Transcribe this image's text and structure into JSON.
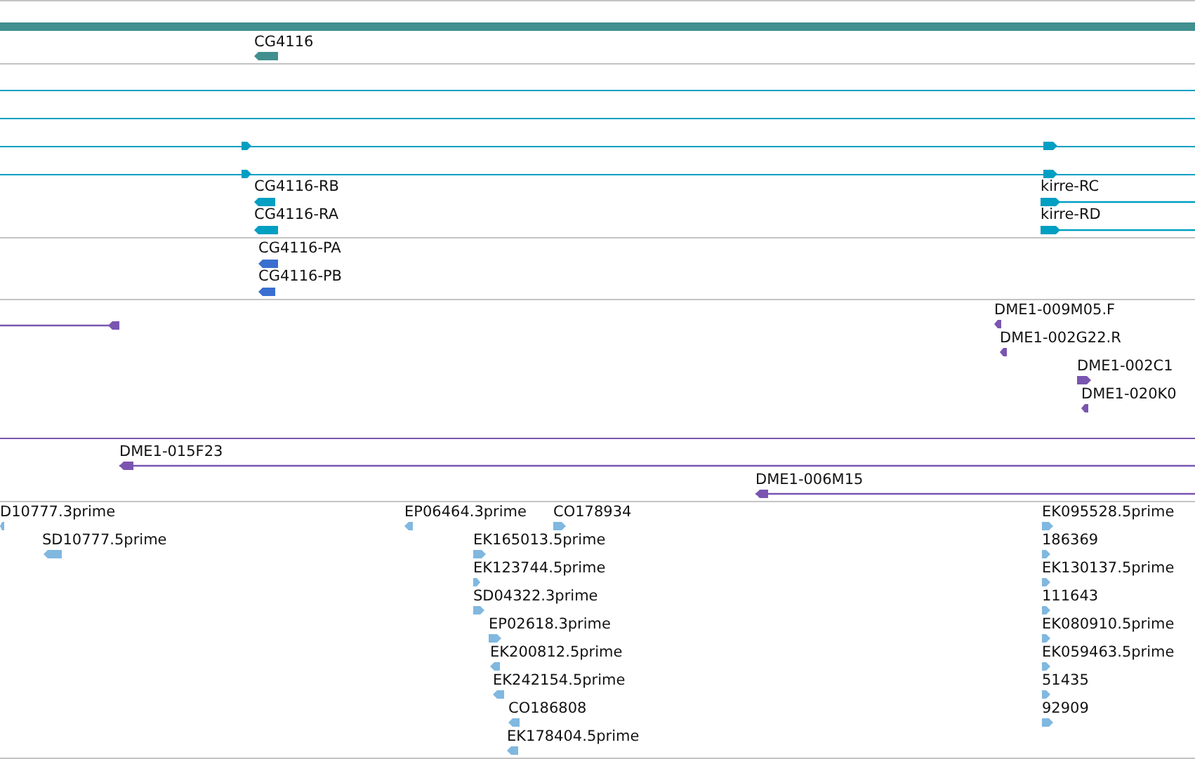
{
  "tracks": [
    {
      "features": [
        {
          "label": "CG4116",
          "reverse": true
        }
      ]
    },
    {
      "features": [
        {
          "reverse": false
        },
        {
          "reverse": false
        },
        {
          "reverse": false
        },
        {
          "reverse": false
        },
        {
          "label": "CG4116-RB",
          "reverse": true
        },
        {
          "label": "CG4116-RA",
          "reverse": true
        },
        {
          "label": "kirre-RC",
          "reverse": false
        },
        {
          "label": "kirre-RD",
          "reverse": false
        }
      ]
    },
    {
      "features": [
        {
          "label": "CG4116-PA",
          "reverse": true
        },
        {
          "label": "CG4116-PB",
          "reverse": true
        }
      ]
    },
    {
      "features": [
        {
          "reverse": true
        },
        {
          "label": "DME1-009M05.F",
          "reverse": true
        },
        {
          "label": "DME1-002G22.R",
          "reverse": true
        },
        {
          "label": "DME1-002C1",
          "reverse": false
        },
        {
          "label": "DME1-020K0",
          "reverse": true
        },
        {
          "label": "DME1-015F23",
          "reverse": true
        },
        {
          "label": "DME1-006M15",
          "reverse": true
        }
      ]
    },
    {
      "features": [
        {
          "label": "D10777.3prime",
          "reverse": true
        },
        {
          "label": "SD10777.5prime",
          "reverse": true
        },
        {
          "label": "EP06464.3prime",
          "reverse": true
        },
        {
          "label": "CO178934",
          "reverse": false
        },
        {
          "label": "EK165013.5prime",
          "reverse": false
        },
        {
          "label": "EK123744.5prime",
          "reverse": false
        },
        {
          "label": "SD04322.3prime",
          "reverse": false
        },
        {
          "label": "EP02618.3prime",
          "reverse": false
        },
        {
          "label": "EK200812.5prime",
          "reverse": true
        },
        {
          "label": "EK242154.5prime",
          "reverse": true
        },
        {
          "label": "CO186808",
          "reverse": true
        },
        {
          "label": "EK178404.5prime",
          "reverse": true
        },
        {
          "label": "EK095528.5prime",
          "reverse": false
        },
        {
          "label": "186369",
          "reverse": false
        },
        {
          "label": "EK130137.5prime",
          "reverse": false
        },
        {
          "label": "111643",
          "reverse": false
        },
        {
          "label": "EK080910.5prime",
          "reverse": false
        },
        {
          "label": "EK059463.5prime",
          "reverse": false
        },
        {
          "label": "51435",
          "reverse": false
        },
        {
          "label": "92909",
          "reverse": false
        }
      ]
    }
  ]
}
